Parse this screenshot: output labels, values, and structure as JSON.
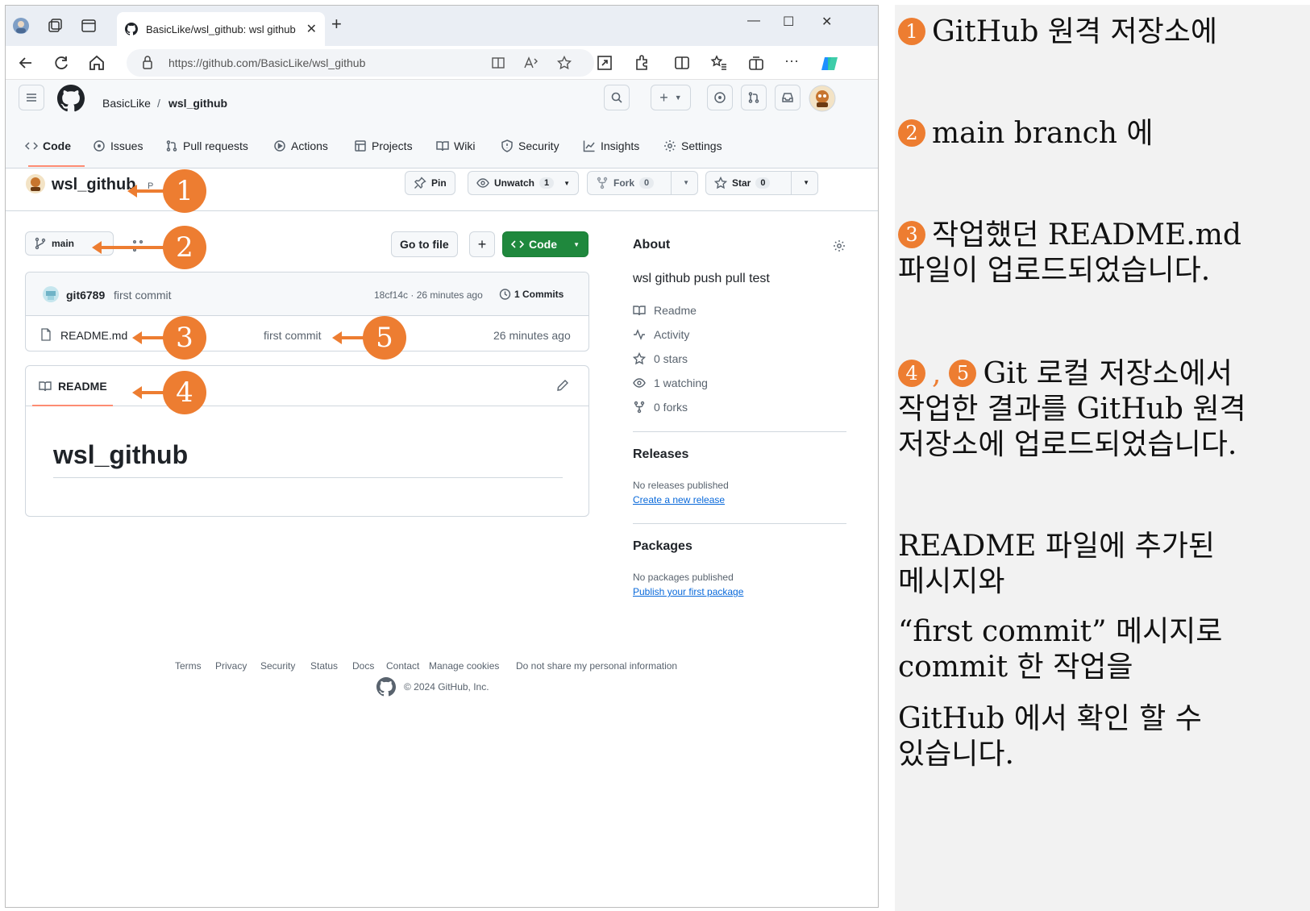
{
  "browser": {
    "tab_title": "BasicLike/wsl_github: wsl github",
    "url": "https://github.com/BasicLike/wsl_github",
    "new_tab_label": "+"
  },
  "github": {
    "owner": "BasicLike",
    "separator": "/",
    "repo": "wsl_github",
    "repo_visibility_partial": "P",
    "tabs": [
      "Code",
      "Issues",
      "Pull requests",
      "Actions",
      "Projects",
      "Wiki",
      "Security",
      "Insights",
      "Settings"
    ],
    "pin_label": "Pin",
    "unwatch_label": "Unwatch",
    "unwatch_count": "1",
    "fork_label": "Fork",
    "fork_count": "0",
    "star_label": "Star",
    "star_count": "0",
    "branch": "main",
    "go_to_file": "Go to file",
    "add_label": "+",
    "code_button": "Code",
    "commit": {
      "author": "git6789",
      "message": "first commit",
      "hash_time": "18cf14c · 26 minutes ago",
      "commits_count": "1 Commits"
    },
    "files": [
      {
        "name": "README.md",
        "message": "first commit",
        "time": "26 minutes ago"
      }
    ],
    "readme_tab": "README",
    "readme_heading": "wsl_github",
    "about": {
      "title": "About",
      "description": "wsl github push pull test",
      "readme": "Readme",
      "activity": "Activity",
      "stars": "0 stars",
      "watching": "1 watching",
      "forks": "0 forks"
    },
    "releases": {
      "title": "Releases",
      "empty": "No releases published",
      "link": "Create a new release"
    },
    "packages": {
      "title": "Packages",
      "empty": "No packages published",
      "link": "Publish your first package"
    },
    "footer": {
      "links": [
        "Terms",
        "Privacy",
        "Security",
        "Status",
        "Docs",
        "Contact",
        "Manage cookies",
        "Do not share my personal information"
      ],
      "copyright": "© 2024 GitHub, Inc."
    }
  },
  "annotations": [
    "1",
    "2",
    "3",
    "4",
    "5"
  ],
  "notes": {
    "n1": "GitHub 원격 저장소에",
    "n2": "main branch 에",
    "n3_line1": "작업했던 README.md",
    "n3_line2": "파일이 업로드되었습니다.",
    "n45_sep": ",",
    "n45_line1": "Git 로컬 저장소에서",
    "n45_line2": "작업한 결과를 GitHub 원격",
    "n45_line3": "저장소에 업로드되었습니다.",
    "p1_line1": "README 파일에 추가된",
    "p1_line2": "메시지와",
    "p2_line1": "“first commit” 메시지로",
    "p2_line2": "commit 한 작업을",
    "p3_line1": "GitHub 에서 확인 할 수",
    "p3_line2": "있습니다."
  },
  "colors": {
    "annotation": "#ed7d31",
    "code_button": "#1f883d",
    "link": "#0969da",
    "tab_underline": "#fd8c73"
  }
}
